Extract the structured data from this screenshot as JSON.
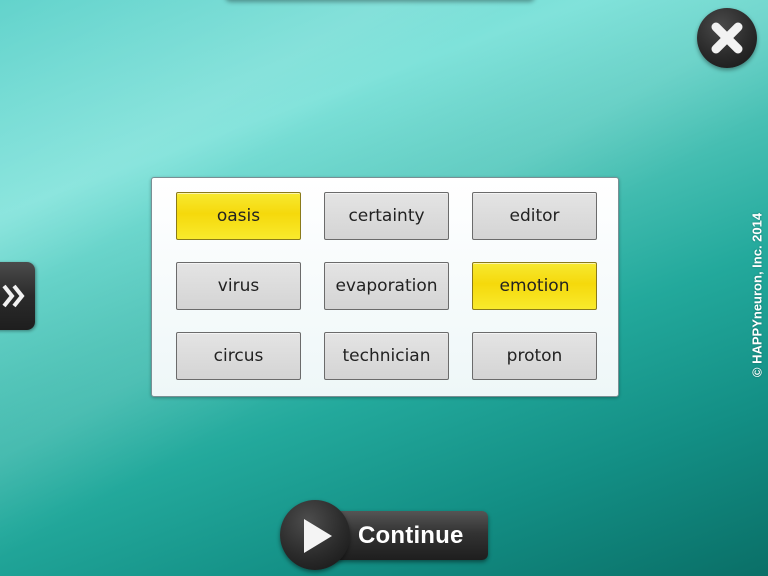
{
  "close_button": {
    "label": "Close",
    "icon": "close-icon"
  },
  "side_tab": {
    "label": "Expand",
    "icon": "double-chevron-right-icon"
  },
  "word_grid": {
    "words": [
      {
        "text": "oasis",
        "selected": true
      },
      {
        "text": "certainty",
        "selected": false
      },
      {
        "text": "editor",
        "selected": false
      },
      {
        "text": "virus",
        "selected": false
      },
      {
        "text": "evaporation",
        "selected": false
      },
      {
        "text": "emotion",
        "selected": true
      },
      {
        "text": "circus",
        "selected": false
      },
      {
        "text": "technician",
        "selected": false
      },
      {
        "text": "proton",
        "selected": false
      }
    ]
  },
  "continue_button": {
    "label": "Continue",
    "icon": "play-icon"
  },
  "copyright": "© HAPPYneuron, Inc. 2014",
  "colors": {
    "selected": "#f5d90c",
    "unselected": "#dcdcdc",
    "background": "#3fbcb0",
    "button_dark": "#2b2b2b"
  }
}
